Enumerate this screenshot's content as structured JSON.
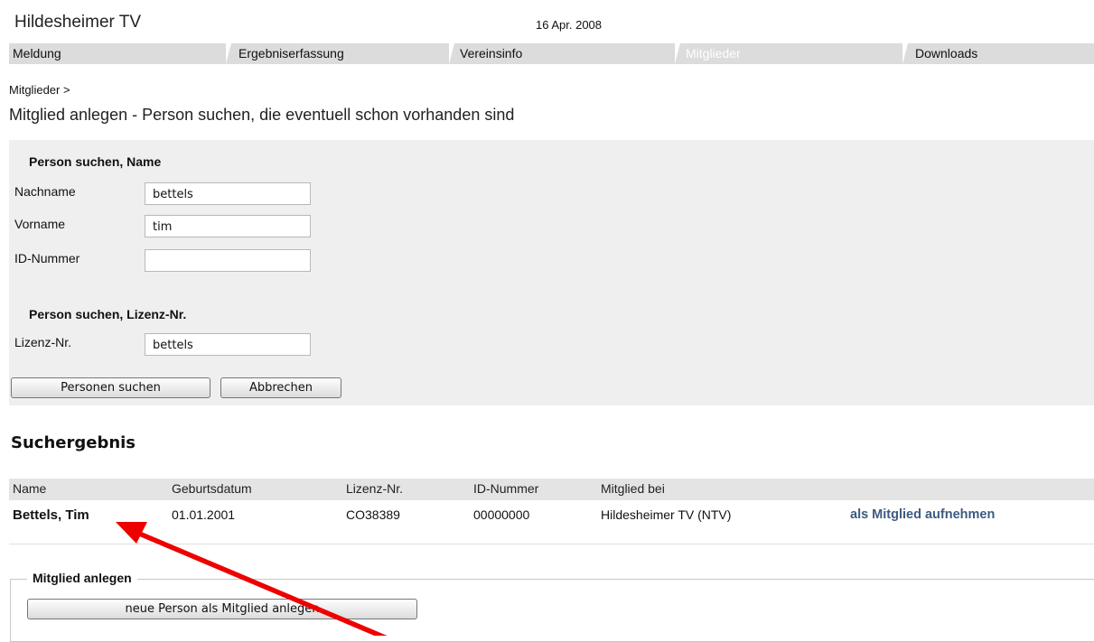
{
  "header": {
    "site_title": "Hildesheimer TV",
    "date": "16 Apr. 2008"
  },
  "nav": {
    "tabs": [
      {
        "label": "Meldung",
        "active": false
      },
      {
        "label": "Ergebniserfassung",
        "active": false
      },
      {
        "label": "Vereinsinfo",
        "active": false
      },
      {
        "label": "Mitglieder",
        "active": true
      },
      {
        "label": "Downloads",
        "active": false
      }
    ]
  },
  "breadcrumb": "Mitglieder >",
  "page_title": "Mitglied anlegen - Person suchen, die eventuell schon vorhanden sind",
  "search_name": {
    "title": "Person suchen, Name",
    "fields": [
      {
        "label": "Nachname",
        "value": "bettels"
      },
      {
        "label": "Vorname",
        "value": "tim"
      },
      {
        "label": "ID-Nummer",
        "value": ""
      }
    ]
  },
  "search_license": {
    "title": "Person suchen, Lizenz-Nr.",
    "field": {
      "label": "Lizenz-Nr.",
      "value": "bettels"
    }
  },
  "buttons": {
    "search": "Personen suchen",
    "cancel": "Abbrechen"
  },
  "results": {
    "title": "Suchergebnis",
    "columns": [
      "Name",
      "Geburtsdatum",
      "Lizenz-Nr.",
      "ID-Nummer",
      "Mitglied bei"
    ],
    "rows": [
      {
        "name": "Bettels, Tim",
        "birthdate": "01.01.2001",
        "license": "CO38389",
        "id": "00000000",
        "club": "Hildesheimer TV (NTV)",
        "action": "als Mitglied aufnehmen"
      }
    ]
  },
  "create_member": {
    "legend": "Mitglied anlegen",
    "button": "neue Person als Mitglied anlegen"
  },
  "colors": {
    "nav_bg": "#dcdcdc",
    "panel_bg": "#efefef",
    "link": "#3d5a80",
    "arrow": "#ee0000"
  }
}
